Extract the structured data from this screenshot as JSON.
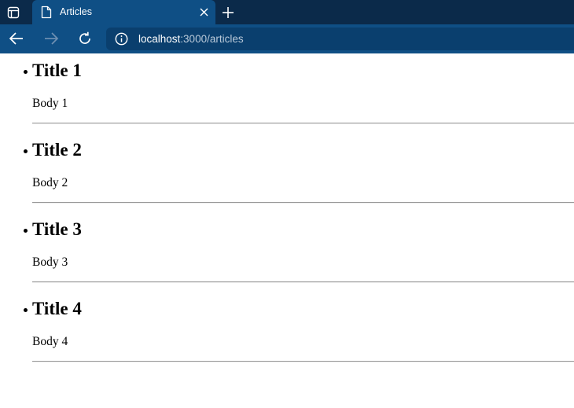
{
  "browser": {
    "tab": {
      "title": "Articles"
    },
    "address": {
      "host": "localhost",
      "path": ":3000/articles"
    },
    "colors": {
      "tabbar": "#0b2a4a",
      "toolbar": "#0f4f85",
      "address_bar": "#0a3f6e"
    }
  },
  "articles": [
    {
      "title": "Title 1",
      "body": "Body 1"
    },
    {
      "title": "Title 2",
      "body": "Body 2"
    },
    {
      "title": "Title 3",
      "body": "Body 3"
    },
    {
      "title": "Title 4",
      "body": "Body 4"
    }
  ]
}
